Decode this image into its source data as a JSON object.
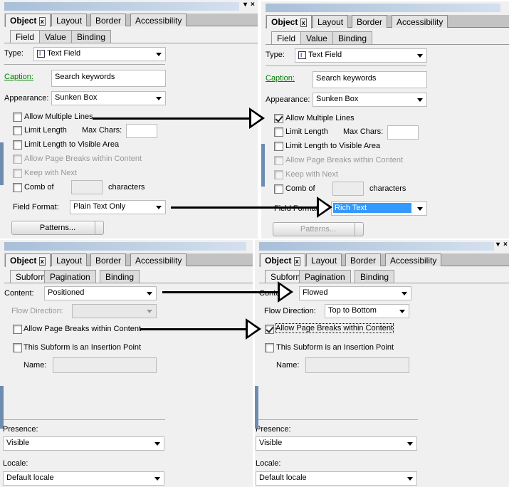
{
  "window": {
    "min_icon": "dropdown-icon",
    "close_icon": "close-icon"
  },
  "tabs": {
    "object": "Object",
    "layout": "Layout",
    "border": "Border",
    "accessibility": "Accessibility"
  },
  "field_panels": [
    {
      "subtabs": [
        "Field",
        "Value",
        "Binding"
      ],
      "type_label": "Type:",
      "type_value": "Text Field",
      "caption_label": "Caption:",
      "caption_value": "Search keywords",
      "appearance_label": "Appearance:",
      "appearance_value": "Sunken Box",
      "allow_multiple_lines": "Allow Multiple Lines",
      "allow_multiple_lines_checked": false,
      "limit_length": "Limit Length",
      "max_chars": "Max Chars:",
      "limit_visible": "Limit Length to Visible Area",
      "allow_page_breaks": "Allow Page Breaks within Content",
      "keep_with_next": "Keep with Next",
      "comb_of": "Comb of",
      "characters": "characters",
      "field_format_label": "Field Format:",
      "field_format_value": "Plain Text Only",
      "patterns": "Patterns..."
    },
    {
      "subtabs": [
        "Field",
        "Value",
        "Binding"
      ],
      "type_label": "Type:",
      "type_value": "Text Field",
      "caption_label": "Caption:",
      "caption_value": "Search keywords",
      "appearance_label": "Appearance:",
      "appearance_value": "Sunken Box",
      "allow_multiple_lines": "Allow Multiple Lines",
      "allow_multiple_lines_checked": true,
      "limit_length": "Limit Length",
      "max_chars": "Max Chars:",
      "limit_visible": "Limit Length to Visible Area",
      "allow_page_breaks": "Allow Page Breaks within Content",
      "keep_with_next": "Keep with Next",
      "comb_of": "Comb of",
      "characters": "characters",
      "field_format_label": "Field Format:",
      "field_format_value": "Rich Text",
      "patterns": "Patterns..."
    }
  ],
  "subform_panels": [
    {
      "subtabs": [
        "Subform",
        "Pagination",
        "Binding"
      ],
      "content_label": "Content:",
      "content_value": "Positioned",
      "flow_direction_label": "Flow Direction:",
      "flow_direction_value": "",
      "allow_page_breaks": "Allow Page Breaks within Content",
      "allow_page_breaks_checked": false,
      "insertion_point": "This Subform is an Insertion Point",
      "name_label": "Name:",
      "presence_label": "Presence:",
      "presence_value": "Visible",
      "locale_label": "Locale:",
      "locale_value": "Default locale"
    },
    {
      "subtabs": [
        "Subform",
        "Pagination",
        "Binding"
      ],
      "content_label": "Content:",
      "content_value": "Flowed",
      "flow_direction_label": "Flow Direction:",
      "flow_direction_value": "Top to Bottom",
      "allow_page_breaks": "Allow Page Breaks within Content",
      "allow_page_breaks_checked": true,
      "insertion_point": "This Subform is an Insertion Point",
      "name_label": "Name:",
      "presence_label": "Presence:",
      "presence_value": "Visible",
      "locale_label": "Locale:",
      "locale_value": "Default locale"
    }
  ],
  "colors": {
    "caption_link": "#008000",
    "selection": "#3399ff",
    "title_bar": "#b4c8de"
  }
}
